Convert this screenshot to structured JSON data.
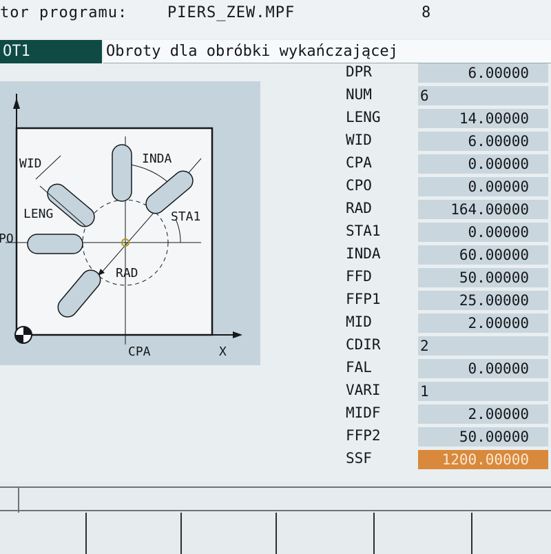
{
  "header": {
    "label": "tor programu:",
    "program": "PIERS_ZEW.MPF",
    "number": "8"
  },
  "title": {
    "tag": "OT1",
    "text": "Obroty dla obróbki wykańczającej"
  },
  "diagram": {
    "labels": {
      "wid": "WID",
      "leng": "LENG",
      "inda": "INDA",
      "sta1": "STA1",
      "rad": "RAD",
      "cpo": "PO",
      "cpa": "CPA",
      "x": "X"
    }
  },
  "params": [
    {
      "name": "DPR",
      "value": "6.00000",
      "type": "real"
    },
    {
      "name": "NUM",
      "value": "6",
      "type": "int"
    },
    {
      "name": "LENG",
      "value": "14.00000",
      "type": "real"
    },
    {
      "name": "WID",
      "value": "6.00000",
      "type": "real"
    },
    {
      "name": "CPA",
      "value": "0.00000",
      "type": "real"
    },
    {
      "name": "CPO",
      "value": "0.00000",
      "type": "real"
    },
    {
      "name": "RAD",
      "value": "164.00000",
      "type": "real"
    },
    {
      "name": "STA1",
      "value": "0.00000",
      "type": "real"
    },
    {
      "name": "INDA",
      "value": "60.00000",
      "type": "real"
    },
    {
      "name": "FFD",
      "value": "50.00000",
      "type": "real"
    },
    {
      "name": "FFP1",
      "value": "25.00000",
      "type": "real"
    },
    {
      "name": "MID",
      "value": "2.00000",
      "type": "real"
    },
    {
      "name": "CDIR",
      "value": "2",
      "type": "int"
    },
    {
      "name": "FAL",
      "value": "0.00000",
      "type": "real"
    },
    {
      "name": "VARI",
      "value": "1",
      "type": "int"
    },
    {
      "name": "MIDF",
      "value": "2.00000",
      "type": "real"
    },
    {
      "name": "FFP2",
      "value": "50.00000",
      "type": "real"
    },
    {
      "name": "SSF",
      "value": "1200.00000",
      "type": "real",
      "selected": true
    }
  ],
  "colors": {
    "title_tag_bg": "#0f4a44",
    "field_bg": "#c9d6de",
    "selected_bg": "#d9893b",
    "diagram_bg": "#c5d3dc"
  }
}
